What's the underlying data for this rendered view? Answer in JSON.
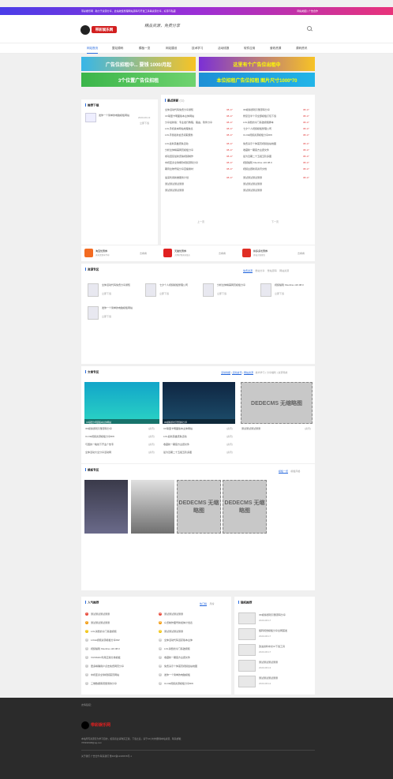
{
  "topbar": {
    "left": "带彩娱乐网 · 助力于资源分享，此站收集整理网站源码与开发工具等资源分享，好源不私藏",
    "right": "网站地图 | 广告合作"
  },
  "header": {
    "logo": "带彩娱乐网",
    "slogan": "精品资源，免费分享"
  },
  "nav": [
    "网站首页",
    "整站源码",
    "模板一览",
    "网站建设",
    "技术学习",
    "活动线报",
    "软件应用",
    "营收资源",
    "源码资讯"
  ],
  "banners": {
    "b1": "广告位招租中... 要钱 1000/月起",
    "b2": "这里有个广告位出租中",
    "b3": "3个位置广告位招租",
    "b4": "本位招租广告位招租 图片尺寸1000*70"
  },
  "recommend": {
    "title": "推荐下载",
    "item": "发你一个简单的电脑模板网站",
    "date": "2020-06-13",
    "btn": "立即下载"
  },
  "latest": {
    "title": "最近更新",
    "count": "(11)",
    "rows": [
      [
        "全体活动代码免费分享通知",
        "08-17",
        "3D模拟游戏引擎源码分享",
        "08-17"
      ],
      [
        "CF联盟卡明面版本主体网站",
        "08-17",
        "修复近半个月全部模板打包下载",
        "08-17"
      ],
      [
        "分享最新版：专业发行教程，路由，软件分享",
        "08-17",
        "LOL消费的冷门基础视频脚本",
        "08-17"
      ],
      [
        "LOL手机版本网站地理信息",
        "08-17",
        "七夕个人视频模板整理公司",
        "08-17"
      ],
      [
        "LOL手游最新会员领取服务",
        "08-17",
        "CLCE视频资源模板分享RW",
        "08-17"
      ],
      [
        "LOL最新英雄皮肤活动",
        "08-17",
        "免费演示个体首页视频会站地图",
        "08-17"
      ],
      [
        "分析全体精美网页模板分享",
        "08-17",
        "收藏新一期官方主题文件",
        "08-17"
      ],
      [
        "成功回复最新皮肤视频制作",
        "08-17",
        "最为近期二十五组五阶多图",
        "08-17"
      ],
      [
        "中视亚泰全球爆款视频源码分享",
        "08-17",
        "视频编辑 Kitenline v20.08.0",
        "08-17"
      ],
      [
        "期待全物号段分享直播素材",
        "08-17",
        "视频主题新闻资讯文档",
        "08-17"
      ],
      [
        "速来利用新推服务计划",
        "08-17",
        "测试测试测试测测",
        "08-17"
      ],
      [
        "测试测试测试测测",
        "",
        "测试测试测试测测",
        ""
      ],
      [
        "测试测试测试测测",
        "",
        "测试测试测试测测",
        ""
      ]
    ],
    "prev": "上一页",
    "next": "下一页",
    "more": "浏览更多"
  },
  "apps": [
    {
      "name": "淘宝优惠券",
      "sub": "天天优惠享不停",
      "btn": "去看看",
      "c": "#f36b21"
    },
    {
      "name": "天猫优惠券",
      "sub": "大牌好物天天低价",
      "btn": "去看看",
      "c": "#e02020"
    },
    {
      "name": "拼多多优惠券",
      "sub": "拼着买更便宜",
      "btn": "去看看",
      "c": "#e02e24"
    }
  ],
  "resources": {
    "title": "资源专区",
    "tabs": [
      "免费资源",
      "整站分享",
      "整站源码",
      "网站资源"
    ],
    "items": [
      "全体活动代码免费分享通知",
      "七夕个人视频模板整理公司",
      "分析全体精美网页模板分享",
      "视频编辑 Kitenline v20.08.0",
      "发你一个简单的电脑模板网站"
    ],
    "btn": "立即下载"
  },
  "articles": {
    "title": "文章专区",
    "tabs": [
      "活动线报",
      "活动资讯",
      "网站资源",
      "技术学习",
      "分享福利",
      "资源导航"
    ],
    "cols": [
      [
        "3D模拟游戏引擎源码分享",
        "CLCE视频资源模板分享RW",
        "与国的一晚线下开业广告专",
        "全体活动大全分享活动网"
      ],
      [
        "CF联盟卡明面版本主体网站",
        "LOL最新英雄皮肤活动",
        "收藏新一期官方主题文件",
        "最为近期二十五组五阶多图"
      ],
      [
        "测试测试测试测测"
      ]
    ],
    "tag": "[资讯]",
    "thumbtexts": [
      "CF联盟卡明面版本主体网站",
      "3D模拟游戏引擎源码分享"
    ],
    "nothumb": "DEDECMS 无缩略图"
  },
  "templates": {
    "title": "模板专区",
    "tabs": [
      "模板一览",
      "模板风格"
    ],
    "nothumb": "DEDECMS 无缩略图"
  },
  "hot": {
    "title": "人气推荐",
    "tabs": [
      "热门榜",
      "月榜"
    ],
    "left": [
      "测试测试测试测测",
      "测试测试测试测测",
      "LOL消费的冷门基础视频",
      "LOLE视频资源模板分享RW",
      "视频编辑 Kitenline v20.08.0",
      "VUISMAC利用正版分类模板",
      "更多精确用户点击免费网页分享",
      "中视亚泰全球视频首页网站",
      "三维数据客观量测的分享"
    ],
    "right": [
      "测试测试测试测测",
      "众览制作图号新媒体计划表",
      "测试测试测试测测",
      "全体活动代码活跃版本主体",
      "LOL消费的冷门基础视频",
      "收藏新一期官方主题文件",
      "免费演示个体首页视频会站地图",
      "发你一个简单的电脑模板",
      "CLCE视频资源模板分享RW"
    ]
  },
  "tags": {
    "title": "随机推荐",
    "items": [
      [
        "3D模拟游戏引擎源码分享",
        "2020-08-17"
      ],
      [
        "旋转视觉模板分享全网首发",
        "2020-08-17"
      ],
      [
        "改进资料中文UI下载工具",
        "2020-08-17"
      ],
      [
        "测试测试测试测测",
        "2020-08-13"
      ],
      [
        "测试测试测试测测",
        "2020-08-12"
      ]
    ]
  },
  "footer": {
    "links": "友情链接：",
    "logo": "带彩娱乐网",
    "desc": "本站所有资源仅为学习目的，如需商业请购买正版，下载之后，请于24小时内删除本站资源，联系邮箱：",
    "mail": "765394908@qq.com",
    "bottom": "关于我们   广告合作   联系我们   豫ICP备12345678号-1"
  }
}
